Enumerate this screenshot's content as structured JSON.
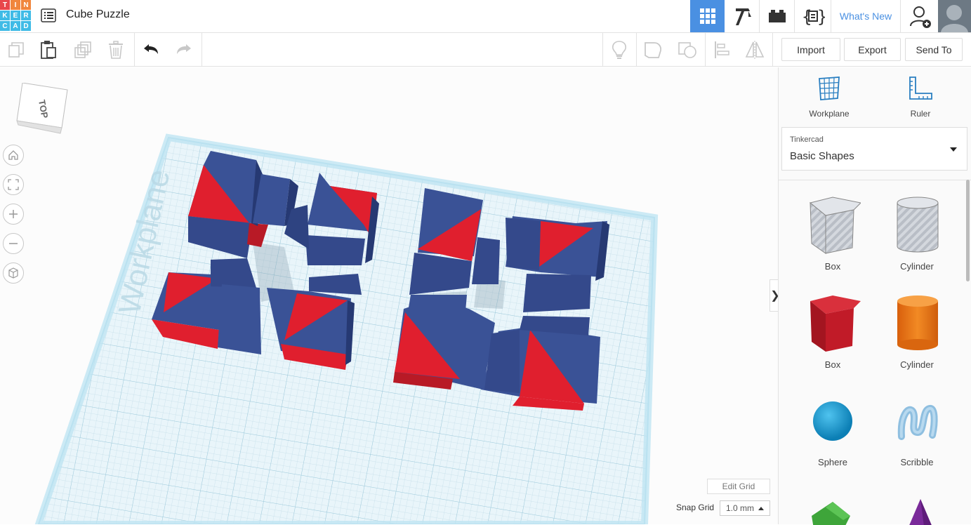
{
  "header": {
    "logo_letters": [
      "T",
      "I",
      "N",
      "K",
      "E",
      "R",
      "C",
      "A",
      "D"
    ],
    "logo_colors": [
      "#e8464b",
      "#f0863d",
      "#f0863d",
      "#3fbbe6",
      "#3fbbe6",
      "#3fbbe6",
      "#3fbbe6",
      "#3fbbe6",
      "#3fbbe6"
    ],
    "title": "Cube Puzzle",
    "whats_new": "What's New",
    "icons": [
      "grid-view-icon",
      "pickaxe-icon",
      "brick-icon",
      "codeblocks-icon",
      "add-user-icon",
      "avatar"
    ]
  },
  "toolbar": {
    "left_icons": [
      "copy-icon",
      "paste-icon",
      "duplicate-icon",
      "delete-icon",
      "undo-icon",
      "redo-icon"
    ],
    "right_icons": [
      "light-bulb-icon",
      "group-icon",
      "ungroup-icon",
      "align-icon",
      "mirror-icon"
    ],
    "import_label": "Import",
    "export_label": "Export",
    "send_to_label": "Send To"
  },
  "viewport": {
    "viewcube_label": "TOP",
    "workplane_text": "Workplane",
    "collapse_label": "❯",
    "edit_grid_label": "Edit Grid",
    "snap_grid_label": "Snap Grid",
    "snap_grid_value": "1.0 mm"
  },
  "panel": {
    "workplane_label": "Workplane",
    "ruler_label": "Ruler",
    "library_small": "Tinkercad",
    "library_name": "Basic Shapes",
    "shapes": [
      {
        "label": "Box"
      },
      {
        "label": "Cylinder"
      },
      {
        "label": "Box"
      },
      {
        "label": "Cylinder"
      },
      {
        "label": "Sphere"
      },
      {
        "label": "Scribble"
      }
    ]
  },
  "colors": {
    "accent": "#4a90e2",
    "piece_blue": "#3a5296",
    "piece_red": "#e01f2e",
    "grid_blue": "#bfe3f0"
  }
}
